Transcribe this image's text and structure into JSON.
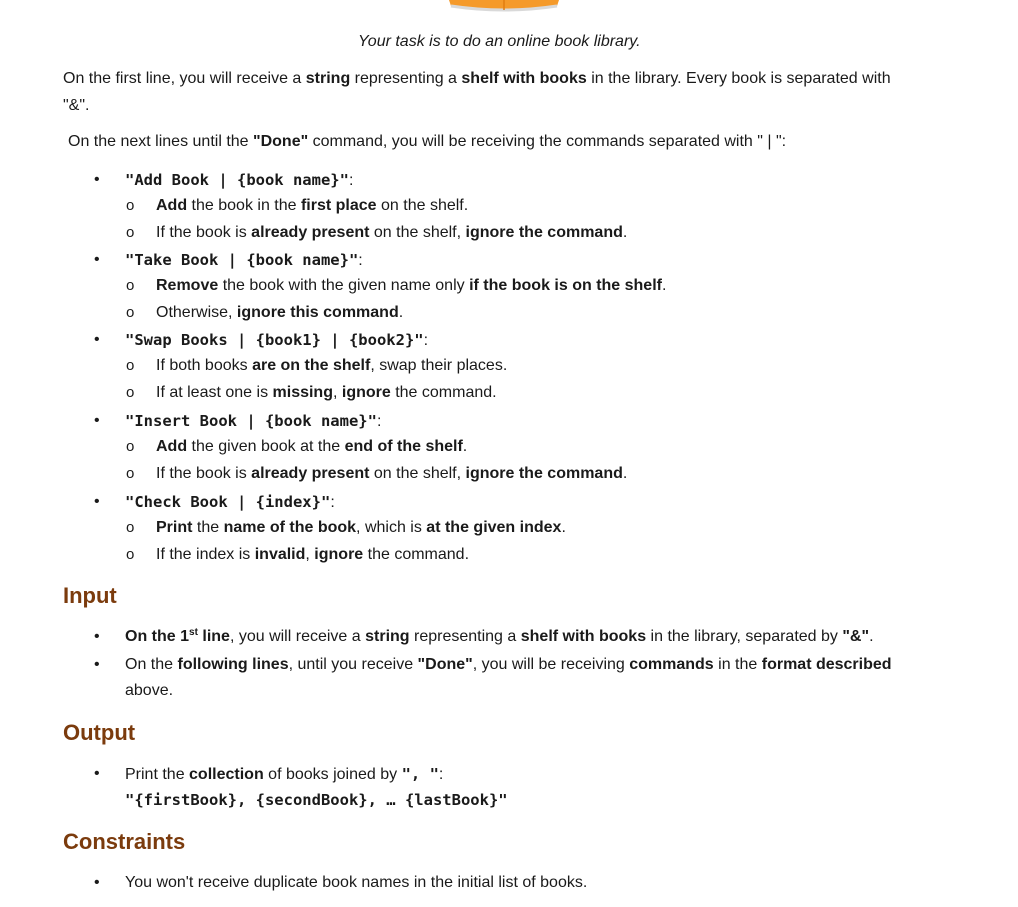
{
  "intro": "Your task is to do an online book library.",
  "p1": {
    "line1": {
      "a": "On the first line, you will receive a ",
      "b1": "string",
      "c": " representing a ",
      "b2": "shelf with books",
      "d": " in the library. Every book is separated with"
    },
    "line2": "\"&\"."
  },
  "p2": {
    "a": "On the next lines until the ",
    "b1": "\"Done\"",
    "c": " command, you will be receiving the commands separated with \"  |  \":"
  },
  "commands": [
    {
      "code": "\"Add Book | {book name}\"",
      "suffix": ":",
      "items": [
        {
          "parts": [
            [
              "b",
              "Add"
            ],
            [
              "n",
              " the book in the "
            ],
            [
              "b",
              "first place"
            ],
            [
              "n",
              " on the shelf."
            ]
          ]
        },
        {
          "parts": [
            [
              "n",
              "If the book is "
            ],
            [
              "b",
              "already present"
            ],
            [
              "n",
              " on the shelf, "
            ],
            [
              "b",
              "ignore the command"
            ],
            [
              "n",
              "."
            ]
          ]
        }
      ]
    },
    {
      "code": "\"Take Book | {book name}\"",
      "suffix": ":",
      "items": [
        {
          "parts": [
            [
              "b",
              "Remove"
            ],
            [
              "n",
              " the book with the given name only "
            ],
            [
              "b",
              "if the book is on the shelf"
            ],
            [
              "n",
              "."
            ]
          ]
        },
        {
          "parts": [
            [
              "n",
              "Otherwise, "
            ],
            [
              "b",
              "ignore this command"
            ],
            [
              "n",
              "."
            ]
          ]
        }
      ]
    },
    {
      "code": "\"Swap Books | {book1} | {book2}\"",
      "suffix": ":",
      "items": [
        {
          "parts": [
            [
              "n",
              "If both books "
            ],
            [
              "b",
              "are on the shelf"
            ],
            [
              "n",
              ", swap their places."
            ]
          ]
        },
        {
          "parts": [
            [
              "n",
              "If at least one is "
            ],
            [
              "b",
              "missing"
            ],
            [
              "n",
              ", "
            ],
            [
              "b",
              "ignore"
            ],
            [
              "n",
              " the command."
            ]
          ]
        }
      ]
    },
    {
      "code": "\"Insert Book | {book name}\"",
      "suffix": ":",
      "items": [
        {
          "parts": [
            [
              "b",
              "Add"
            ],
            [
              "n",
              " the given book at the "
            ],
            [
              "b",
              "end of the shelf"
            ],
            [
              "n",
              "."
            ]
          ]
        },
        {
          "parts": [
            [
              "n",
              "If the book is "
            ],
            [
              "b",
              "already present"
            ],
            [
              "n",
              " on the shelf, "
            ],
            [
              "b",
              "ignore the command"
            ],
            [
              "n",
              "."
            ]
          ]
        }
      ]
    },
    {
      "code": "\"Check Book | {index}\"",
      "suffix": ":",
      "items": [
        {
          "parts": [
            [
              "b",
              "Print"
            ],
            [
              "n",
              " the "
            ],
            [
              "b",
              "name of the book"
            ],
            [
              "n",
              ", which is "
            ],
            [
              "b",
              "at the given index"
            ],
            [
              "n",
              "."
            ]
          ]
        },
        {
          "parts": [
            [
              "n",
              "If the index is "
            ],
            [
              "b",
              "invalid"
            ],
            [
              "n",
              ", "
            ],
            [
              "b",
              "ignore"
            ],
            [
              "n",
              " the command."
            ]
          ]
        }
      ]
    }
  ],
  "input": {
    "heading": "Input",
    "b1": {
      "a": "On the 1",
      "sup": "st",
      "b": " line",
      "c": ", you will receive a ",
      "d": "string",
      "e": " representing a ",
      "f": "shelf with books",
      "g": " in the library, separated by ",
      "h": "\"&\"",
      "i": "."
    },
    "b2": {
      "a": "On the ",
      "b": "following lines",
      "c": ", until you receive ",
      "d": "\"Done\"",
      "e": ", you will be receiving ",
      "f": "commands",
      "g": " in the ",
      "h": "format described"
    },
    "b2_line2": "above."
  },
  "output": {
    "heading": "Output",
    "b1": {
      "a": "Print the ",
      "b": "collection",
      "c": " of books joined by ",
      "d": "\", \"",
      "e": ":"
    },
    "format": "\"{firstBook}, {secondBook}, … {lastBook}\""
  },
  "constraints": {
    "heading": "Constraints",
    "b1": "You won't receive duplicate book names in the initial list of books."
  },
  "colors": {
    "heading": "#7b3b0d",
    "text": "#1a1a1a",
    "book": "#f59a2a"
  }
}
